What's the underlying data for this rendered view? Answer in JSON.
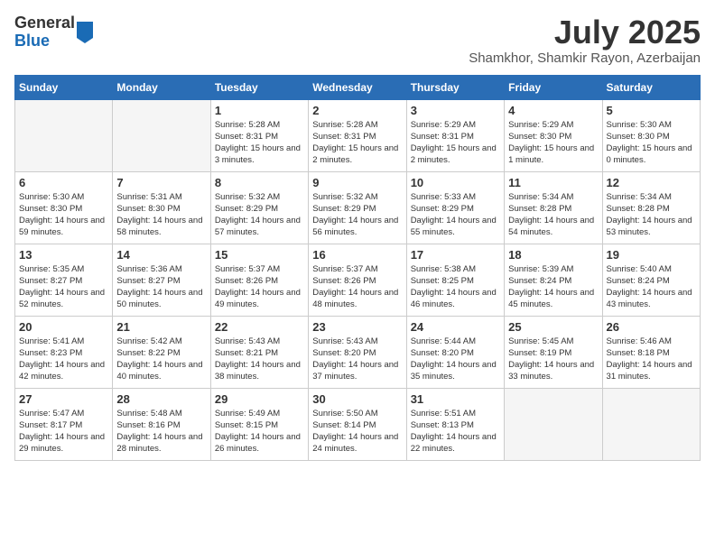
{
  "header": {
    "logo_general": "General",
    "logo_blue": "Blue",
    "month_title": "July 2025",
    "location": "Shamkhor, Shamkir Rayon, Azerbaijan"
  },
  "days_of_week": [
    "Sunday",
    "Monday",
    "Tuesday",
    "Wednesday",
    "Thursday",
    "Friday",
    "Saturday"
  ],
  "weeks": [
    [
      {
        "day": "",
        "info": ""
      },
      {
        "day": "",
        "info": ""
      },
      {
        "day": "1",
        "info": "Sunrise: 5:28 AM\nSunset: 8:31 PM\nDaylight: 15 hours\nand 3 minutes."
      },
      {
        "day": "2",
        "info": "Sunrise: 5:28 AM\nSunset: 8:31 PM\nDaylight: 15 hours\nand 2 minutes."
      },
      {
        "day": "3",
        "info": "Sunrise: 5:29 AM\nSunset: 8:31 PM\nDaylight: 15 hours\nand 2 minutes."
      },
      {
        "day": "4",
        "info": "Sunrise: 5:29 AM\nSunset: 8:30 PM\nDaylight: 15 hours\nand 1 minute."
      },
      {
        "day": "5",
        "info": "Sunrise: 5:30 AM\nSunset: 8:30 PM\nDaylight: 15 hours\nand 0 minutes."
      }
    ],
    [
      {
        "day": "6",
        "info": "Sunrise: 5:30 AM\nSunset: 8:30 PM\nDaylight: 14 hours\nand 59 minutes."
      },
      {
        "day": "7",
        "info": "Sunrise: 5:31 AM\nSunset: 8:30 PM\nDaylight: 14 hours\nand 58 minutes."
      },
      {
        "day": "8",
        "info": "Sunrise: 5:32 AM\nSunset: 8:29 PM\nDaylight: 14 hours\nand 57 minutes."
      },
      {
        "day": "9",
        "info": "Sunrise: 5:32 AM\nSunset: 8:29 PM\nDaylight: 14 hours\nand 56 minutes."
      },
      {
        "day": "10",
        "info": "Sunrise: 5:33 AM\nSunset: 8:29 PM\nDaylight: 14 hours\nand 55 minutes."
      },
      {
        "day": "11",
        "info": "Sunrise: 5:34 AM\nSunset: 8:28 PM\nDaylight: 14 hours\nand 54 minutes."
      },
      {
        "day": "12",
        "info": "Sunrise: 5:34 AM\nSunset: 8:28 PM\nDaylight: 14 hours\nand 53 minutes."
      }
    ],
    [
      {
        "day": "13",
        "info": "Sunrise: 5:35 AM\nSunset: 8:27 PM\nDaylight: 14 hours\nand 52 minutes."
      },
      {
        "day": "14",
        "info": "Sunrise: 5:36 AM\nSunset: 8:27 PM\nDaylight: 14 hours\nand 50 minutes."
      },
      {
        "day": "15",
        "info": "Sunrise: 5:37 AM\nSunset: 8:26 PM\nDaylight: 14 hours\nand 49 minutes."
      },
      {
        "day": "16",
        "info": "Sunrise: 5:37 AM\nSunset: 8:26 PM\nDaylight: 14 hours\nand 48 minutes."
      },
      {
        "day": "17",
        "info": "Sunrise: 5:38 AM\nSunset: 8:25 PM\nDaylight: 14 hours\nand 46 minutes."
      },
      {
        "day": "18",
        "info": "Sunrise: 5:39 AM\nSunset: 8:24 PM\nDaylight: 14 hours\nand 45 minutes."
      },
      {
        "day": "19",
        "info": "Sunrise: 5:40 AM\nSunset: 8:24 PM\nDaylight: 14 hours\nand 43 minutes."
      }
    ],
    [
      {
        "day": "20",
        "info": "Sunrise: 5:41 AM\nSunset: 8:23 PM\nDaylight: 14 hours\nand 42 minutes."
      },
      {
        "day": "21",
        "info": "Sunrise: 5:42 AM\nSunset: 8:22 PM\nDaylight: 14 hours\nand 40 minutes."
      },
      {
        "day": "22",
        "info": "Sunrise: 5:43 AM\nSunset: 8:21 PM\nDaylight: 14 hours\nand 38 minutes."
      },
      {
        "day": "23",
        "info": "Sunrise: 5:43 AM\nSunset: 8:20 PM\nDaylight: 14 hours\nand 37 minutes."
      },
      {
        "day": "24",
        "info": "Sunrise: 5:44 AM\nSunset: 8:20 PM\nDaylight: 14 hours\nand 35 minutes."
      },
      {
        "day": "25",
        "info": "Sunrise: 5:45 AM\nSunset: 8:19 PM\nDaylight: 14 hours\nand 33 minutes."
      },
      {
        "day": "26",
        "info": "Sunrise: 5:46 AM\nSunset: 8:18 PM\nDaylight: 14 hours\nand 31 minutes."
      }
    ],
    [
      {
        "day": "27",
        "info": "Sunrise: 5:47 AM\nSunset: 8:17 PM\nDaylight: 14 hours\nand 29 minutes."
      },
      {
        "day": "28",
        "info": "Sunrise: 5:48 AM\nSunset: 8:16 PM\nDaylight: 14 hours\nand 28 minutes."
      },
      {
        "day": "29",
        "info": "Sunrise: 5:49 AM\nSunset: 8:15 PM\nDaylight: 14 hours\nand 26 minutes."
      },
      {
        "day": "30",
        "info": "Sunrise: 5:50 AM\nSunset: 8:14 PM\nDaylight: 14 hours\nand 24 minutes."
      },
      {
        "day": "31",
        "info": "Sunrise: 5:51 AM\nSunset: 8:13 PM\nDaylight: 14 hours\nand 22 minutes."
      },
      {
        "day": "",
        "info": ""
      },
      {
        "day": "",
        "info": ""
      }
    ]
  ]
}
